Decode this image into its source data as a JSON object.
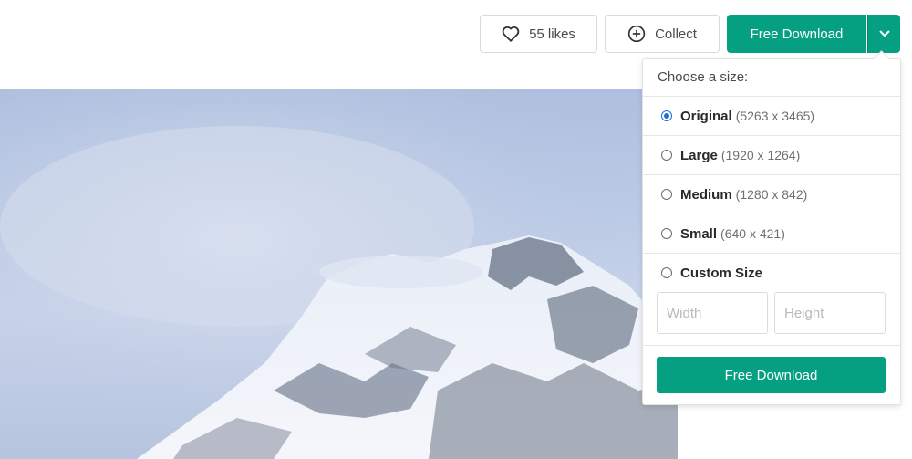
{
  "toolbar": {
    "likes_label": "55 likes",
    "collect_label": "Collect",
    "download_label": "Free Download"
  },
  "dropdown": {
    "title": "Choose a size:",
    "options": [
      {
        "label": "Original",
        "dims": "(5263 x 3465)",
        "checked": true
      },
      {
        "label": "Large",
        "dims": "(1920 x 1264)",
        "checked": false
      },
      {
        "label": "Medium",
        "dims": "(1280 x 842)",
        "checked": false
      },
      {
        "label": "Small",
        "dims": "(640 x 421)",
        "checked": false
      }
    ],
    "custom": {
      "label": "Custom Size",
      "width_placeholder": "Width",
      "height_placeholder": "Height"
    },
    "download_label": "Free Download"
  },
  "colors": {
    "accent": "#05a081",
    "radio_selected": "#1e6fd9"
  },
  "icons": [
    "heart-icon",
    "plus-circle-icon",
    "chevron-down-icon"
  ]
}
